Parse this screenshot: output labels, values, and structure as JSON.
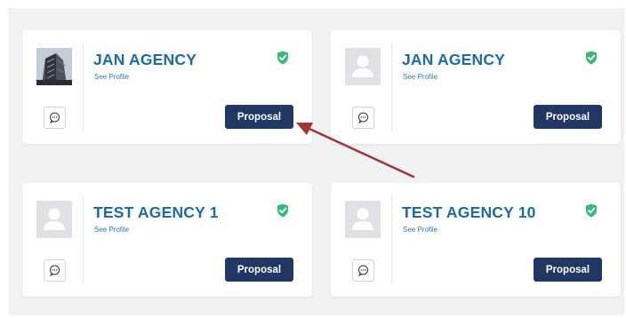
{
  "agencies": [
    {
      "name": "JAN AGENCY",
      "see_profile": "See Profile",
      "proposal_label": "Proposal",
      "avatar": "building-photo",
      "verified_icon": "shield-check-icon"
    },
    {
      "name": "JAN AGENCY",
      "see_profile": "See Profile",
      "proposal_label": "Proposal",
      "avatar": "user-placeholder-icon",
      "verified_icon": "shield-check-icon"
    },
    {
      "name": "TEST AGENCY 1",
      "see_profile": "See Profile",
      "proposal_label": "Proposal",
      "avatar": "user-placeholder-icon",
      "verified_icon": "shield-check-icon"
    },
    {
      "name": "TEST AGENCY 10",
      "see_profile": "See Profile",
      "proposal_label": "Proposal",
      "avatar": "user-placeholder-icon",
      "verified_icon": "shield-check-icon"
    }
  ],
  "colors": {
    "title": "#1e6aa5",
    "proposal_button": "#213865",
    "verified": "#3cb878",
    "annotation_arrow": "#a23434"
  }
}
